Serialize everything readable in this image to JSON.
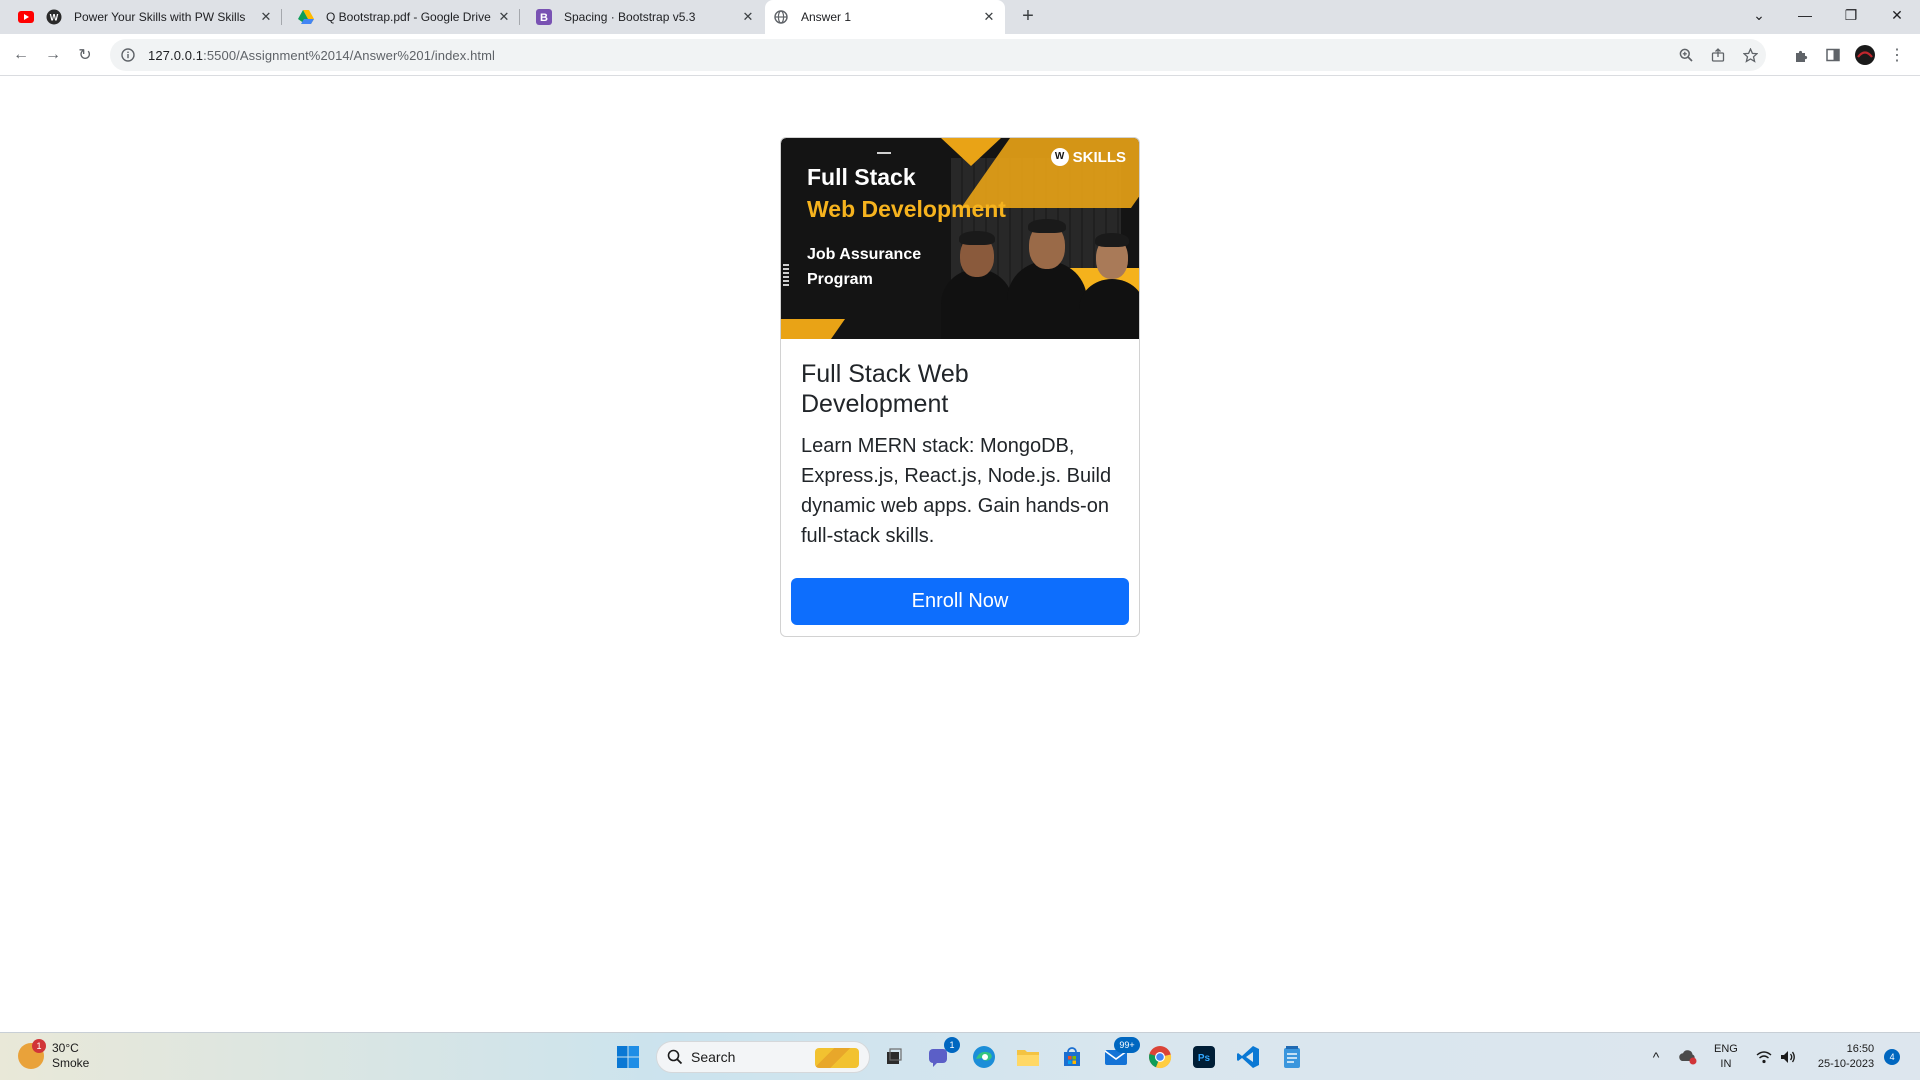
{
  "browser": {
    "tabs": [
      {
        "title": "Power Your Skills with PW Skills",
        "favicon": "youtube-icon"
      },
      {
        "title": "Q Bootstrap.pdf - Google Drive",
        "favicon": "google-drive-icon"
      },
      {
        "title": "Spacing · Bootstrap v5.3",
        "favicon": "bootstrap-icon"
      },
      {
        "title": "Answer 1",
        "favicon": "globe-icon",
        "active": true
      }
    ],
    "url_host": "127.0.0.1",
    "url_rest": ":5500/Assignment%2014/Answer%201/index.html"
  },
  "card": {
    "banner": {
      "line1": "Full Stack",
      "line2": "Web Development",
      "line3": "Job Assurance Program",
      "logo_text": "SKILLS"
    },
    "title": "Full Stack Web Development",
    "text": "Learn MERN stack: MongoDB, Express.js, React.js, Node.js. Build dynamic web apps. Gain hands-on full-stack skills.",
    "button_label": "Enroll Now",
    "button_color": "#0d6efd"
  },
  "taskbar": {
    "weather_temp": "30°C",
    "weather_desc": "Smoke",
    "weather_badge": "1",
    "search_label": "Search",
    "teams_badge": "1",
    "mail_badge": "99+",
    "lang_top": "ENG",
    "lang_bottom": "IN",
    "time": "16:50",
    "date": "25-10-2023",
    "notifications": "4"
  }
}
